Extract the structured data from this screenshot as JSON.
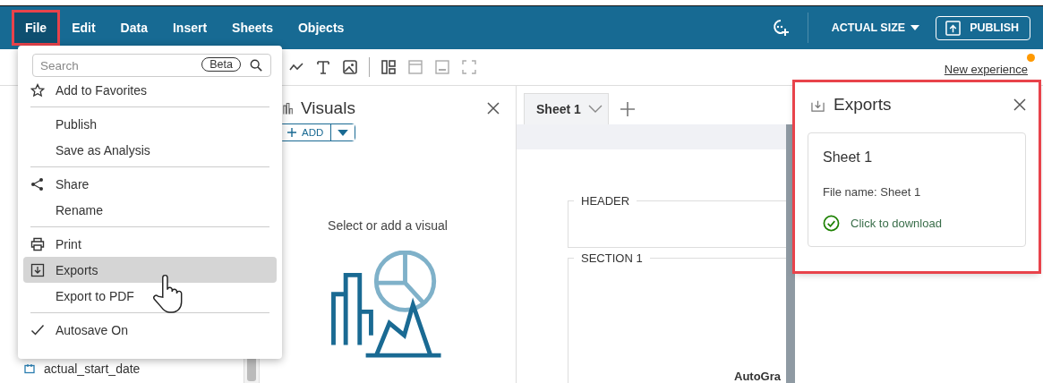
{
  "menubar": {
    "items": [
      {
        "label": "File",
        "selected": true,
        "annotated": true
      },
      {
        "label": "Edit",
        "selected": false,
        "annotated": false
      },
      {
        "label": "Data",
        "selected": false,
        "annotated": false
      },
      {
        "label": "Insert",
        "selected": false,
        "annotated": false
      },
      {
        "label": "Sheets",
        "selected": false,
        "annotated": false
      },
      {
        "label": "Objects",
        "selected": false,
        "annotated": false
      }
    ]
  },
  "zoom": {
    "label": "ACTUAL SIZE"
  },
  "publish_button": {
    "label": "PUBLISH"
  },
  "new_experience": {
    "label": "New experience",
    "notification": true
  },
  "file_menu": {
    "search": {
      "placeholder": "Search",
      "badge": "Beta"
    },
    "sections": [
      [
        {
          "kind": "star",
          "label": "Add to Favorites",
          "selected": false
        }
      ],
      [
        {
          "kind": "plain",
          "label": "Publish",
          "selected": false
        },
        {
          "kind": "plain",
          "label": "Save as Analysis",
          "selected": false
        }
      ],
      [
        {
          "kind": "share",
          "label": "Share",
          "selected": false
        },
        {
          "kind": "plain",
          "label": "Rename",
          "selected": false
        }
      ],
      [
        {
          "kind": "printer",
          "label": "Print",
          "selected": false
        },
        {
          "kind": "download",
          "label": "Exports",
          "selected": true
        },
        {
          "kind": "plain",
          "label": "Export to PDF",
          "selected": false
        }
      ],
      [
        {
          "kind": "check",
          "label": "Autosave On",
          "selected": false,
          "checked": true
        }
      ]
    ]
  },
  "field_list": {
    "items": [
      {
        "label": "actual_start_date"
      }
    ]
  },
  "visuals_panel": {
    "title": "Visuals",
    "add_button": "ADD",
    "empty_text": "Select or add a visual"
  },
  "sheet": {
    "tabs": [
      {
        "label": "Sheet 1",
        "selected": true
      }
    ],
    "sections": [
      {
        "title": "HEADER"
      },
      {
        "title": "SECTION 1"
      }
    ],
    "visual_title": "AutoGra"
  },
  "exports_panel": {
    "title": "Exports",
    "annotated": true,
    "exports": [
      {
        "name": "Sheet 1",
        "file_name": "File name: Sheet 1",
        "status": "Click to download"
      }
    ]
  }
}
